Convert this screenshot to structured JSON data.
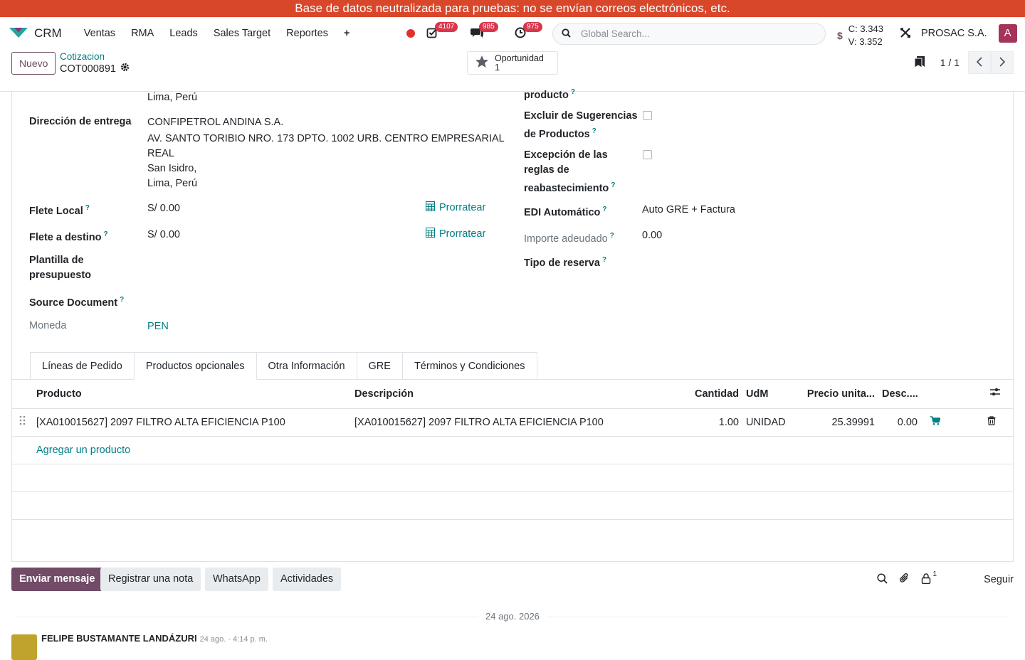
{
  "banner": "Base de datos neutralizada para pruebas: no se envían correos electrónicos, etc.",
  "nav": {
    "app_name": "CRM",
    "menu": [
      "Ventas",
      "RMA",
      "Leads",
      "Sales Target",
      "Reportes"
    ],
    "plus": "+",
    "badges": {
      "activities": "4107",
      "messages": "985",
      "clock": "975"
    },
    "search_placeholder": "Global Search...",
    "fx_currency": "$",
    "fx_c": "C: 3.343",
    "fx_v": "V: 3.352",
    "company": "PROSAC S.A.",
    "avatar_letter": "A"
  },
  "control": {
    "new_label": "Nuevo",
    "breadcrumb_parent": "Cotizacion",
    "breadcrumb_current": "COT000891",
    "smart_label": "Oportunidad",
    "smart_value": "1",
    "pager_value": "1 / 1"
  },
  "form": {
    "top_cut_value": "Lima, Perú",
    "top_cut_right": "producto",
    "delivery_label": "Dirección de entrega",
    "delivery_lines": [
      "CONFIPETROL ANDINA S.A.",
      "AV. SANTO TORIBIO NRO. 173 DPTO. 1002 URB. CENTRO EMPRESARIAL",
      "REAL",
      "San Isidro,",
      "Lima, Perú"
    ],
    "flete_local_label": "Flete Local",
    "flete_local_value": "S/ 0.00",
    "flete_destino_label": "Flete a destino",
    "flete_destino_value": "S/ 0.00",
    "prorratear": "Prorratear",
    "plantilla_label_1": "Plantilla de",
    "plantilla_label_2": "presupuesto",
    "source_label": "Source Document",
    "moneda_label": "Moneda",
    "moneda_value": "PEN",
    "excluir_label_1": "Excluir de Sugerencias",
    "excluir_label_2": "de Productos",
    "excepcion_label_1": "Excepción de las",
    "excepcion_label_2": "reglas de",
    "excepcion_label_3": "reabastecimiento",
    "edi_label": "EDI Automático",
    "edi_value": "Auto GRE + Factura",
    "importe_label": "Importe adeudado",
    "importe_value": "0.00",
    "reserva_label": "Tipo de reserva",
    "help_mark": "?"
  },
  "tabs": [
    "Líneas de Pedido",
    "Productos opcionales",
    "Otra Información",
    "GRE",
    "Términos y Condiciones"
  ],
  "table": {
    "headers": {
      "producto": "Producto",
      "descripcion": "Descripción",
      "cantidad": "Cantidad",
      "udm": "UdM",
      "precio": "Precio unita...",
      "desc": "Desc...."
    },
    "rows": [
      {
        "producto": "[XA010015627] 2097 FILTRO ALTA EFICIENCIA P100",
        "descripcion": "[XA010015627] 2097 FILTRO ALTA EFICIENCIA P100",
        "cantidad": "1.00",
        "udm": "UNIDAD",
        "precio": "25.39991",
        "desc": "0.00"
      }
    ],
    "add_label": "Agregar un producto"
  },
  "chatter": {
    "send": "Enviar mensaje",
    "note": "Registrar una nota",
    "whatsapp": "WhatsApp",
    "activities": "Actividades",
    "followers_count": "1",
    "follow": "Seguir",
    "date": "24 ago. 2026",
    "author": "FELIPE BUSTAMANTE LANDÁZURI",
    "time": "24 ago. · 4:14 p. m."
  },
  "colors": {
    "banner": "#d9472b",
    "primary": "#714B67",
    "link": "#017e84",
    "badge": "#d9364b"
  }
}
